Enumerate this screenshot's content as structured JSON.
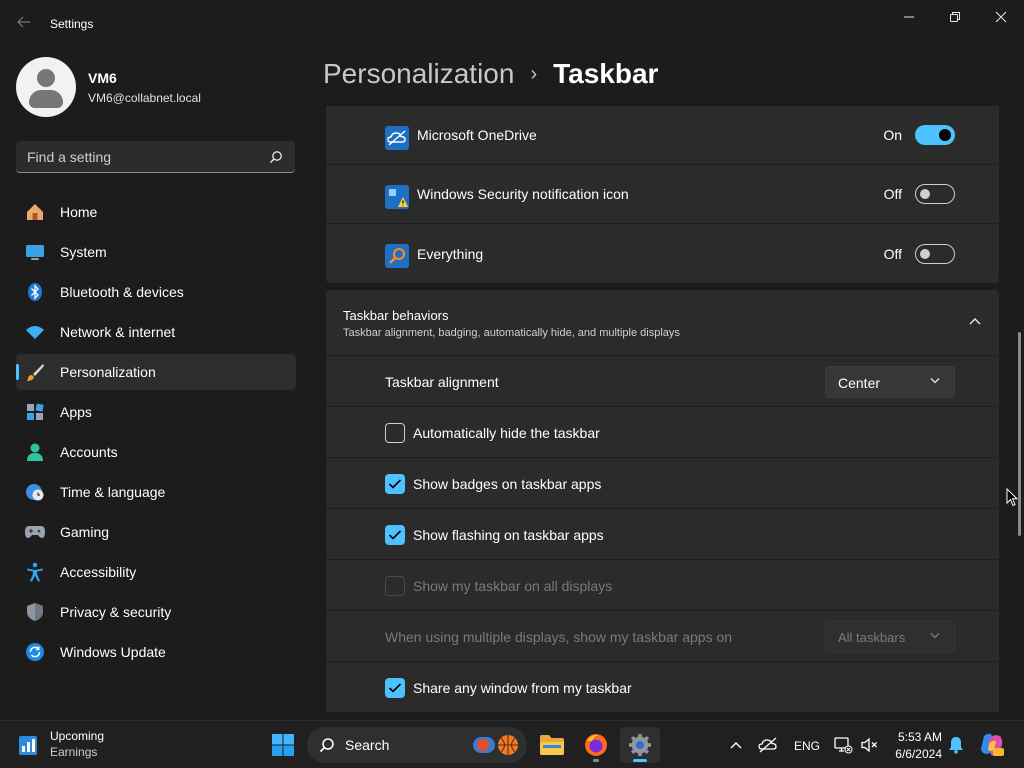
{
  "window": {
    "title": "Settings",
    "back_icon": "arrow-left-icon",
    "minimize_icon": "minimize-icon",
    "maximize_icon": "restore-icon",
    "close_icon": "close-icon"
  },
  "profile": {
    "name": "VM6",
    "email": "VM6@collabnet.local"
  },
  "search": {
    "placeholder": "Find a setting"
  },
  "nav": {
    "items": [
      {
        "label": "Home",
        "icon": "home-icon"
      },
      {
        "label": "System",
        "icon": "monitor-icon"
      },
      {
        "label": "Bluetooth & devices",
        "icon": "bluetooth-icon"
      },
      {
        "label": "Network & internet",
        "icon": "wifi-icon"
      },
      {
        "label": "Personalization",
        "icon": "brush-icon",
        "active": true
      },
      {
        "label": "Apps",
        "icon": "apps-icon"
      },
      {
        "label": "Accounts",
        "icon": "person-icon"
      },
      {
        "label": "Time & language",
        "icon": "globe-clock-icon"
      },
      {
        "label": "Gaming",
        "icon": "gamepad-icon"
      },
      {
        "label": "Accessibility",
        "icon": "accessibility-icon"
      },
      {
        "label": "Privacy & security",
        "icon": "shield-icon"
      },
      {
        "label": "Windows Update",
        "icon": "update-icon"
      }
    ]
  },
  "breadcrumb": {
    "parent": "Personalization",
    "separator": "›",
    "current": "Taskbar"
  },
  "tray_icons": [
    {
      "label": "Microsoft OneDrive",
      "state": "On",
      "on": true
    },
    {
      "label": "Windows Security notification icon",
      "state": "Off",
      "on": false
    },
    {
      "label": "Everything",
      "state": "Off",
      "on": false
    }
  ],
  "behaviors": {
    "title": "Taskbar behaviors",
    "subtitle": "Taskbar alignment, badging, automatically hide, and multiple displays",
    "alignment_label": "Taskbar alignment",
    "alignment_value": "Center",
    "auto_hide": "Automatically hide the taskbar",
    "badges": "Show badges on taskbar apps",
    "flashing": "Show flashing on taskbar apps",
    "all_displays": "Show my taskbar on all displays",
    "multi_label": "When using multiple displays, show my taskbar apps on",
    "multi_value": "All taskbars",
    "share_window": "Share any window from my taskbar"
  },
  "taskbar": {
    "weather_title": "Upcoming",
    "weather_sub": "Earnings",
    "search_label": "Search",
    "language": "ENG",
    "time": "5:53 AM",
    "date": "6/6/2024"
  },
  "colors": {
    "accent": "#4cc2ff",
    "background": "#1c1c1c",
    "card": "#2b2b2b"
  }
}
